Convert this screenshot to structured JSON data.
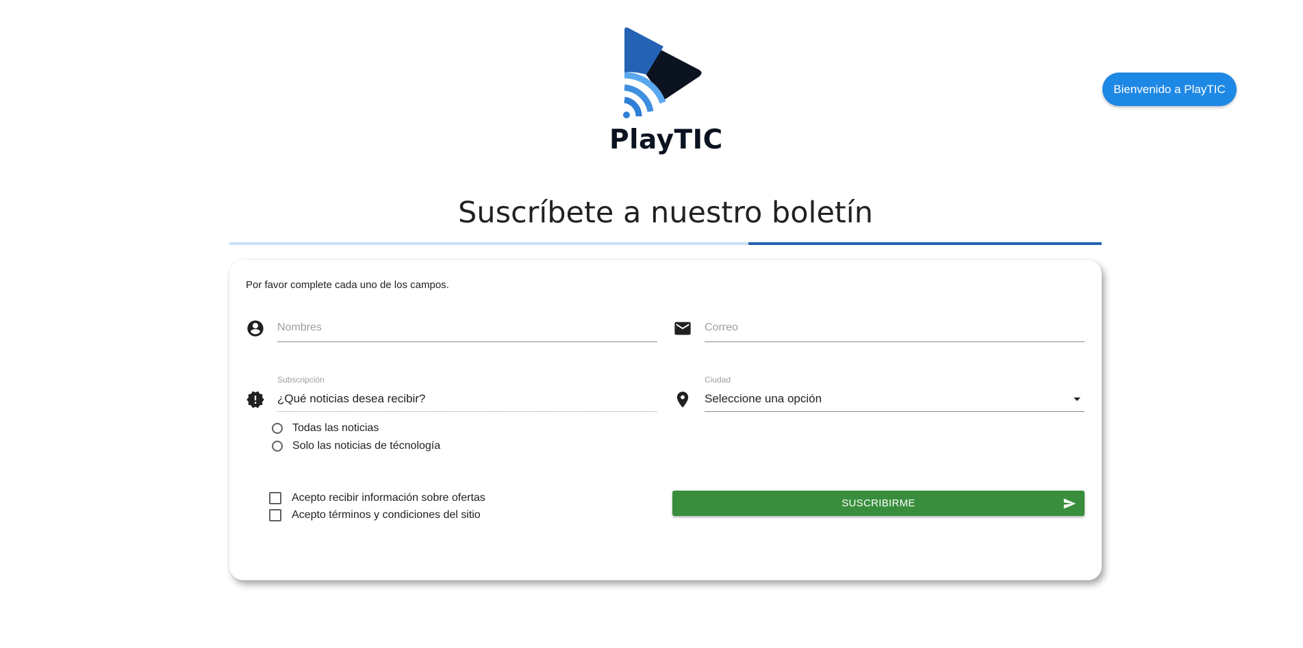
{
  "header": {
    "logo_text": "PlayTIC",
    "logo_icon": "play-wifi-logo-icon",
    "welcome_button": "Bienvenido a PlayTIC"
  },
  "title": {
    "text": "Suscríbete a nuestro boletín"
  },
  "form": {
    "instructions": "Por favor complete cada uno de los campos.",
    "names": {
      "icon": "account-circle-icon",
      "placeholder": "Nombres"
    },
    "email": {
      "icon": "mail-icon",
      "placeholder": "Correo"
    },
    "subscription": {
      "icon": "alert-decagram-icon",
      "label": "Subscripción",
      "value": "¿Qué noticias desea recibir?",
      "options": [
        "Todas las noticias",
        "Solo las noticias de técnología"
      ]
    },
    "city": {
      "icon": "map-marker-icon",
      "label": "Ciudad",
      "value": "Seleccione una opción"
    },
    "checkboxes": [
      "Acepto recibir información sobre ofertas",
      "Acepto términos y condiciones del sitio"
    ],
    "submit": {
      "label": "SUSCRIBIRME",
      "icon": "send-icon"
    }
  },
  "colors": {
    "brand_blue": "#1e88e5",
    "title_rule_light": "#c9e1f7",
    "title_rule_dark": "#2462b3",
    "submit_green": "#388e3c",
    "logo_navy": "#0b1220"
  }
}
